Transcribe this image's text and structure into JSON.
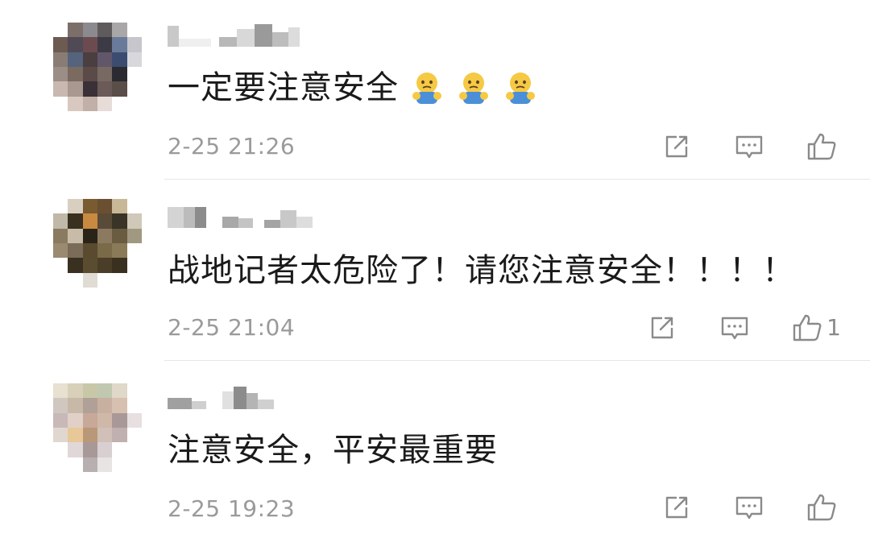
{
  "comments": [
    {
      "text": "一定要注意安全",
      "emoji_icons": [
        "cold-sweat-emoji-icon",
        "cold-sweat-emoji-icon",
        "cold-sweat-emoji-icon"
      ],
      "time": "2-25 21:26",
      "like_count": ""
    },
    {
      "text": "战地记者太危险了！请您注意安全！！！！",
      "emoji_icons": [],
      "time": "2-25 21:04",
      "like_count": "1"
    },
    {
      "text": "注意安全，平安最重要",
      "emoji_icons": [],
      "time": "2-25 19:23",
      "like_count": ""
    }
  ],
  "icons": {
    "share": "share-icon",
    "reply": "reply-icon",
    "like": "thumbs-up-icon"
  },
  "colors": {
    "text": "#1a1a1a",
    "meta": "#9a9a9a",
    "icon": "#8a8a8a",
    "divider": "#e6e6e6"
  }
}
